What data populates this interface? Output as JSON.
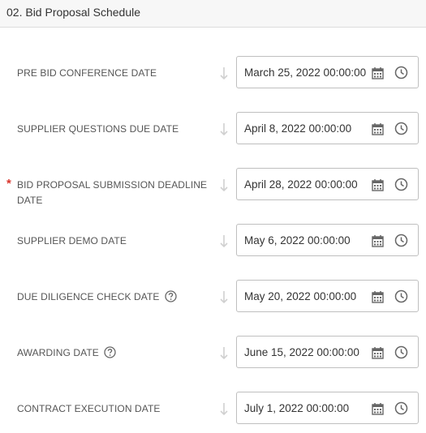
{
  "section": {
    "title": "02. Bid Proposal Schedule"
  },
  "fields": [
    {
      "label": "PRE BID CONFERENCE DATE",
      "value": "March 25, 2022 00:00:00",
      "required": false,
      "help": false
    },
    {
      "label": "SUPPLIER QUESTIONS DUE DATE",
      "value": "April 8, 2022 00:00:00",
      "required": false,
      "help": false
    },
    {
      "label": "BID PROPOSAL SUBMISSION DEADLINE DATE",
      "value": "April 28, 2022 00:00:00",
      "required": true,
      "help": false
    },
    {
      "label": "SUPPLIER DEMO DATE",
      "value": "May 6, 2022 00:00:00",
      "required": false,
      "help": false
    },
    {
      "label": "DUE DILIGENCE CHECK DATE",
      "value": "May 20, 2022 00:00:00",
      "required": false,
      "help": true
    },
    {
      "label": "AWARDING DATE",
      "value": "June 15, 2022 00:00:00",
      "required": false,
      "help": true
    },
    {
      "label": "CONTRACT EXECUTION DATE",
      "value": "July 1, 2022 00:00:00",
      "required": false,
      "help": false
    }
  ],
  "required_marker": "*",
  "icons": {
    "calendar": "calendar-icon",
    "clock": "clock-icon",
    "help": "help-circle-icon",
    "dependency": "dependency-arrow-icon"
  },
  "colors": {
    "required": "#d9342b",
    "border": "#bfbfbf",
    "header_bg": "#f7f7f7"
  }
}
